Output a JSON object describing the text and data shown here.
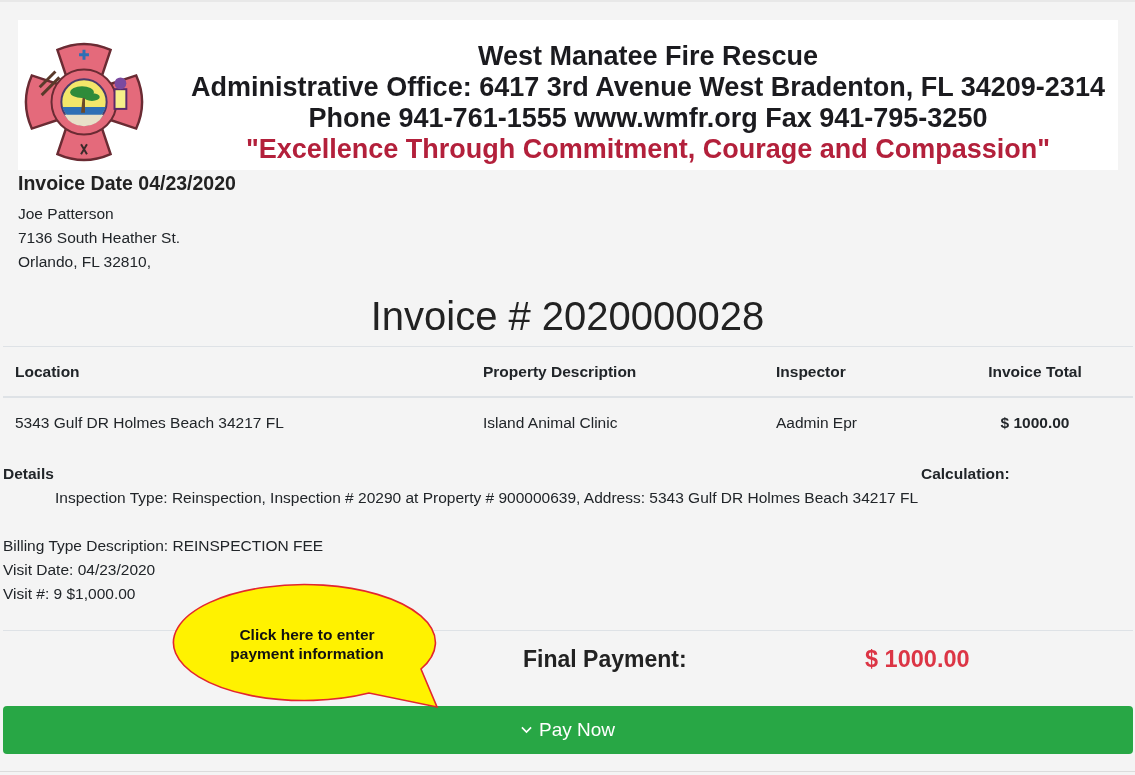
{
  "banner": {
    "title": "West Manatee Fire Rescue",
    "address_line": "Administrative Office: 6417 3rd Avenue West Bradenton, FL 34209-2314",
    "contact_line": "Phone 941-761-1555 www.wmfr.org Fax 941-795-3250",
    "motto": "\"Excellence Through Commitment, Courage and Compassion\""
  },
  "invoice_date": "Invoice Date 04/23/2020",
  "customer_address": [
    "Joe Patterson",
    "7136 South Heather St.",
    "Orlando, FL 32810,"
  ],
  "invoice_number": "Invoice # 2020000028",
  "table": {
    "columns": [
      "Location",
      "Property Description",
      "Inspector",
      "Invoice Total"
    ],
    "rows": [
      [
        "5343 Gulf DR Holmes Beach 34217 FL",
        "Island Animal Clinic",
        "Aadmin Epr",
        "$ 1000.00"
      ]
    ]
  },
  "details": {
    "heading": "Details",
    "calculation_heading": "Calculation:",
    "description": "Inspection Type: Reinspection, Inspection # 20290 at Property # 900000639, Address: 5343 Gulf DR Holmes Beach 34217 FL",
    "lines": [
      "Billing Type Description: REINSPECTION FEE",
      "Visit Date: 04/23/2020",
      "Visit #: 9 $1,000.00"
    ]
  },
  "final_payment": {
    "label": "Final Payment:",
    "amount": "$ 1000.00"
  },
  "callout": {
    "text": "Click here to enter payment information"
  },
  "pay_button": {
    "label": "Pay Now"
  }
}
